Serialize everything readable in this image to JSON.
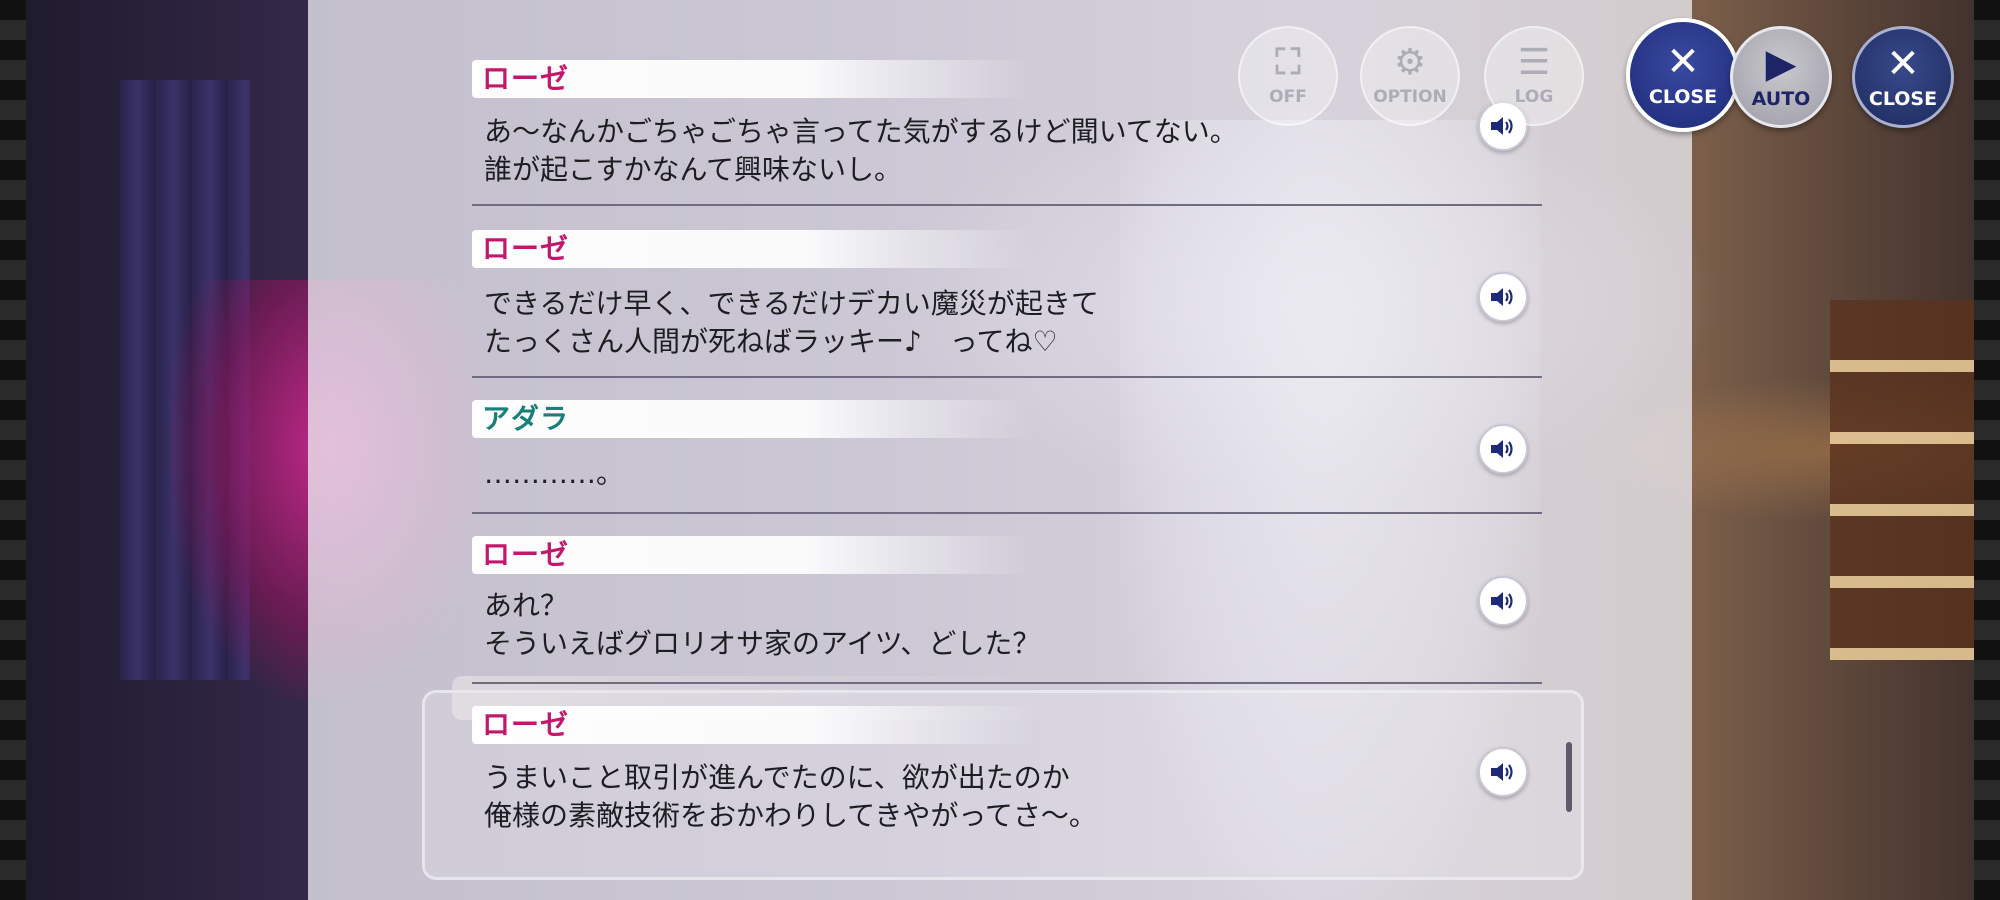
{
  "entries": [
    {
      "speaker": "ローゼ",
      "speaker_color": "#c2186c",
      "line1": "あ〜なんかごちゃごちゃ言ってた気がするけど聞いてない。",
      "line2": "誰が起こすかなんて興味ないし。"
    },
    {
      "speaker": "ローゼ",
      "speaker_color": "#c2186c",
      "line1": "できるだけ早く、できるだけデカい魔災が起きて",
      "line2": "たっくさん人間が死ねばラッキー♪　ってね♡"
    },
    {
      "speaker": "アダラ",
      "speaker_color": "#17807a",
      "line1": "…………。",
      "line2": ""
    },
    {
      "speaker": "ローゼ",
      "speaker_color": "#c2186c",
      "line1": "あれ？",
      "line2": "そういえばグロリオサ家のアイツ、どした？"
    },
    {
      "speaker": "ローゼ",
      "speaker_color": "#c2186c",
      "line1": "うまいこと取引が進んでたのに、欲が出たのか",
      "line2": "俺様の素敵技術をおかわりしてきやがってさ〜。"
    }
  ],
  "controls": {
    "off_label": "OFF",
    "option_label": "OPTION",
    "log_label": "LOG",
    "close_label": "CLOSE",
    "auto_label": "AUTO",
    "close2_label": "CLOSE"
  },
  "icons": {
    "fullscreen": "fullscreen-icon",
    "option": "gear-icon",
    "log": "log-icon",
    "close": "close-icon",
    "auto": "play-icon",
    "voice": "speaker-icon"
  }
}
